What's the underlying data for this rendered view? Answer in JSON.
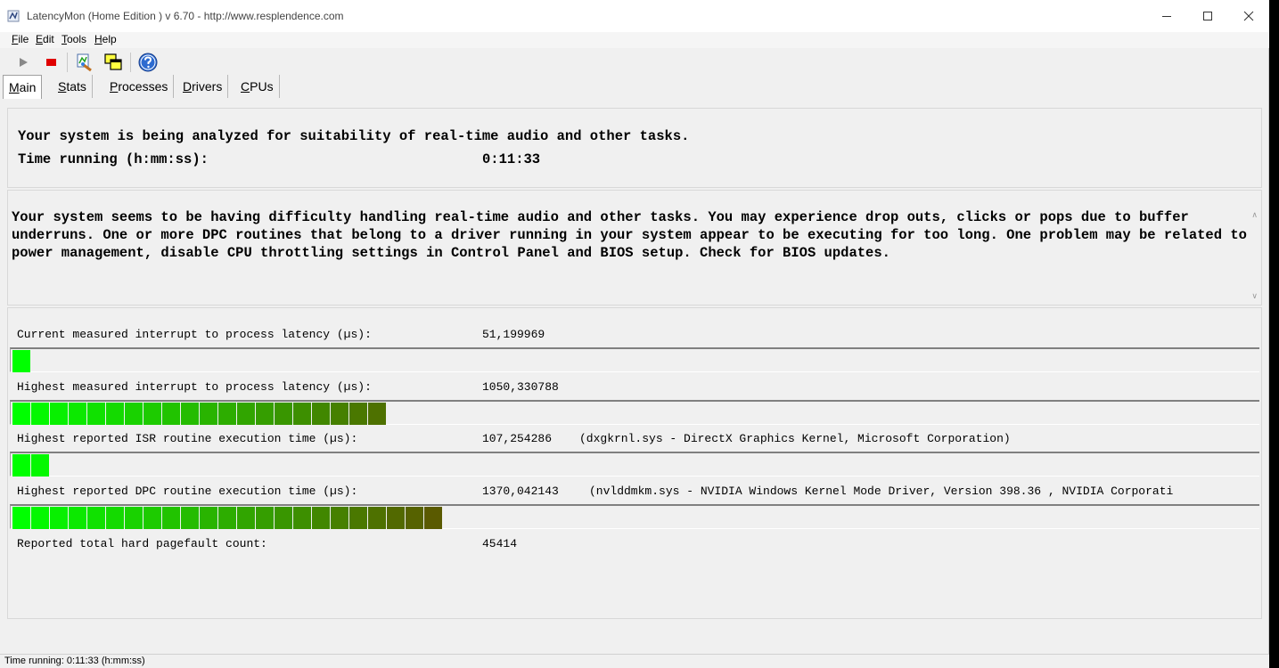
{
  "window": {
    "title": "LatencyMon  (Home Edition )  v 6.70 - http://www.resplendence.com"
  },
  "menu": {
    "file": {
      "u": "F",
      "rest": "ile"
    },
    "edit": {
      "u": "E",
      "rest": "dit"
    },
    "tools": {
      "u": "T",
      "rest": "ools"
    },
    "help": {
      "u": "H",
      "rest": "elp"
    }
  },
  "toolbar": {
    "icons": [
      "play-icon",
      "stop-icon",
      "analyze-icon",
      "windows-icon",
      "help-icon"
    ]
  },
  "tabs": [
    {
      "label": "Main",
      "u": "M",
      "rest": "ain"
    },
    {
      "label": "Stats",
      "u": "S",
      "rest": "tats"
    },
    {
      "label": "Processes",
      "u": "P",
      "rest": "rocesses"
    },
    {
      "label": "Drivers",
      "u": "D",
      "rest": "rivers"
    },
    {
      "label": "CPUs",
      "u": "C",
      "rest": "PUs"
    }
  ],
  "summary": {
    "heading": "Your system is being analyzed for suitability of real-time audio and other tasks.",
    "time_label": "Time running (h:mm:ss):",
    "time_value": "0:11:33"
  },
  "message": {
    "text": "Your system seems to be having difficulty handling real-time audio and other tasks. You may experience drop outs, clicks or pops due to buffer underruns. One or more DPC routines that belong to a driver running in your system appear to be executing for too long. One problem may be related to power management, disable CPU throttling settings in Control Panel and BIOS setup. Check for BIOS updates."
  },
  "metrics": {
    "current_latency": {
      "label": "Current measured interrupt to process latency (µs):",
      "value": "51,199969",
      "segments": 1
    },
    "highest_latency": {
      "label": "Highest measured interrupt to process latency (µs):",
      "value": "1050,330788",
      "segments": 20
    },
    "isr": {
      "label": "Highest reported ISR routine execution time (µs):",
      "value": "107,254286",
      "detail": "(dxgkrnl.sys - DirectX Graphics Kernel, Microsoft Corporation)",
      "segments": 2
    },
    "dpc": {
      "label": "Highest reported DPC routine execution time (µs):",
      "value": "1370,042143",
      "detail": "(nvlddmkm.sys - NVIDIA Windows Kernel Mode Driver, Version 398.36 , NVIDIA Corporati",
      "segments": 23
    },
    "pagefault": {
      "label": "Reported total hard pagefault count:",
      "value": "45414"
    }
  },
  "colors": {
    "bar_start": "#00ff00",
    "bar_end": "#5a5a00"
  },
  "status": {
    "text": "Time running: 0:11:33  (h:mm:ss)"
  }
}
